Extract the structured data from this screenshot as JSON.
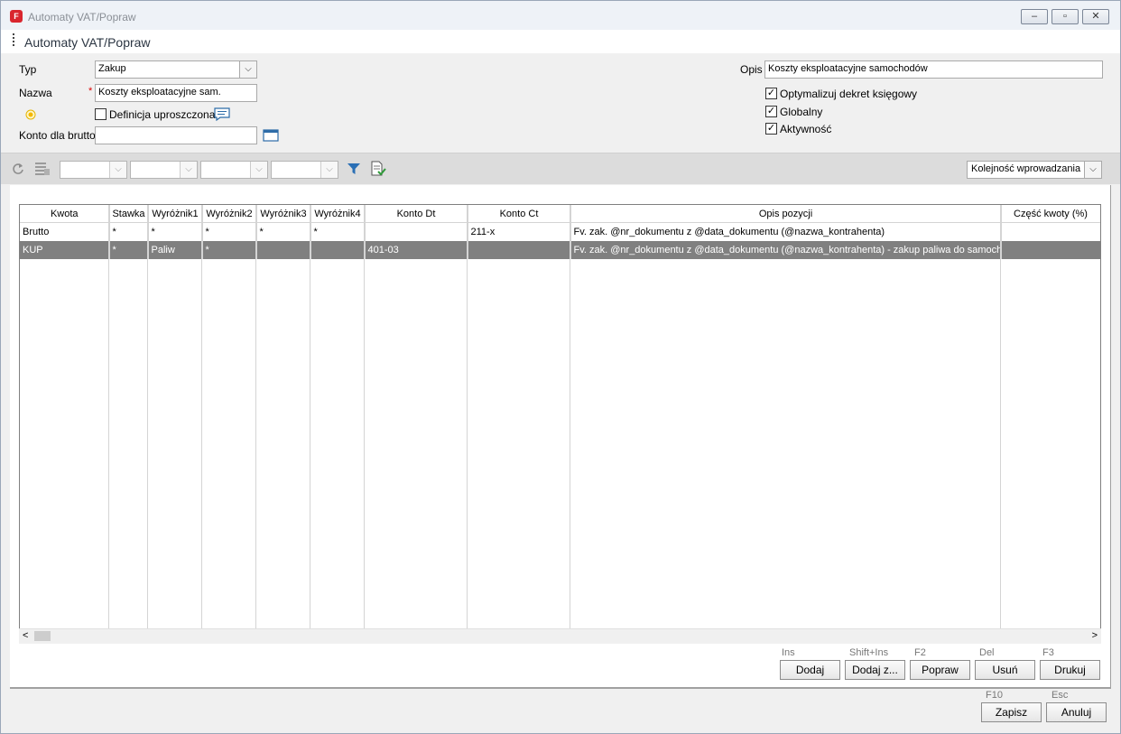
{
  "window": {
    "title": "Automaty VAT/Popraw",
    "logo_letter": "F",
    "minimize_icon": "–",
    "maximize_icon": "▫",
    "close_icon": "✕"
  },
  "page": {
    "title": "Automaty VAT/Popraw"
  },
  "form": {
    "typ_label": "Typ",
    "typ_value": "Zakup",
    "nazwa_label": "Nazwa",
    "nazwa_required": "*",
    "nazwa_value": "Koszty eksploatacyjne sam.",
    "definicja_label": "Definicja uproszczona",
    "definicja_checked": false,
    "konto_brutto_label": "Konto dla brutto",
    "konto_brutto_value": "",
    "opis_label": "Opis",
    "opis_value": "Koszty eksploatacyjne samochodów",
    "optymalizuj_label": "Optymalizuj dekret księgowy",
    "optymalizuj_checked": true,
    "globalny_label": "Globalny",
    "globalny_checked": true,
    "aktywnosc_label": "Aktywność",
    "aktywnosc_checked": true,
    "check_mark": "✓"
  },
  "toolbar": {
    "sort_value": "Kolejność wprowadzania",
    "combo_arrow": "⌵"
  },
  "table": {
    "columns": [
      "Kwota",
      "Stawka",
      "Wyróżnik1",
      "Wyróżnik2",
      "Wyróżnik3",
      "Wyróżnik4",
      "Konto Dt",
      "Konto Ct",
      "Opis pozycji",
      "Część kwoty (%)"
    ],
    "rows": [
      [
        "Brutto",
        "*",
        "*",
        "*",
        "*",
        "*",
        "",
        "211-x",
        "Fv. zak. @nr_dokumentu z @data_dokumentu (@nazwa_kontrahenta)",
        ""
      ],
      [
        "KUP",
        "*",
        "Paliw",
        "*",
        "",
        "",
        "401-03",
        "",
        "Fv. zak. @nr_dokumentu z @data_dokumentu (@nazwa_kontrahenta) - zakup paliwa do samochodu",
        ""
      ]
    ],
    "selected_row": 1,
    "scroll_left": "<",
    "scroll_right": ">"
  },
  "actions": {
    "dodaj": {
      "key": "Ins",
      "label": "Dodaj"
    },
    "dodaj_z": {
      "key": "Shift+Ins",
      "label": "Dodaj z..."
    },
    "popraw": {
      "key": "F2",
      "label": "Popraw"
    },
    "usun": {
      "key": "Del",
      "label": "Usuń"
    },
    "drukuj": {
      "key": "F3",
      "label": "Drukuj"
    }
  },
  "footer": {
    "zapisz": {
      "key": "F10",
      "label": "Zapisz"
    },
    "anuluj": {
      "key": "Esc",
      "label": "Anuluj"
    }
  },
  "colors": {
    "selected_row_bg": "#808080",
    "required_mark": "#dd0000",
    "logo_red": "#d9262e",
    "filter_icon": "#2a6fb5"
  }
}
